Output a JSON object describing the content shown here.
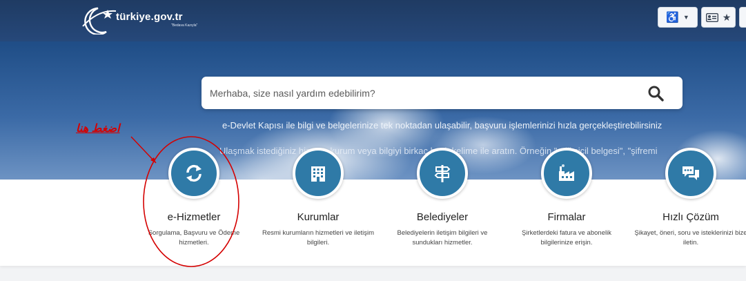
{
  "header": {
    "logo_text": "türkiye.gov.tr",
    "logo_sub": "\"Bedava Kazıyla\""
  },
  "search": {
    "placeholder": "Merhaba, size nasıl yardım edebilirim?"
  },
  "hero": {
    "description": "e-Devlet Kapısı ile bilgi ve belgelerinize tek noktadan ulaşabilir, başvuru işlemlerinizi hızla gerçekleştirebilirsiniz",
    "hint": "Ulaşmak istediğiniz hizmet, kurum veya bilgiyi birkaç basit kelime ile aratın. Örneğin \"adli sicil belgesi\", \"şifremi"
  },
  "cards": [
    {
      "title": "e-Hizmetler",
      "desc": "Sorgulama, Başvuru ve Ödeme hizmetleri.",
      "icon": "refresh-icon"
    },
    {
      "title": "Kurumlar",
      "desc": "Resmi kurumların hizmetleri ve iletişim bilgileri.",
      "icon": "building-icon"
    },
    {
      "title": "Belediyeler",
      "desc": "Belediyelerin iletişim bilgileri ve sundukları hizmetler.",
      "icon": "signpost-icon"
    },
    {
      "title": "Firmalar",
      "desc": "Şirketlerdeki fatura ve abonelik bilgilerinize erişin.",
      "icon": "factory-icon"
    },
    {
      "title": "Hızlı Çözüm",
      "desc": "Şikayet, öneri, soru ve isteklerinizi bize iletin.",
      "icon": "chat-bubbles-icon"
    }
  ],
  "annotation": {
    "text": "اضغط هنا"
  },
  "colors": {
    "header_bg": "#1f3b63",
    "card_icon_bg": "#2f7aa7",
    "annotation": "#d40000"
  }
}
